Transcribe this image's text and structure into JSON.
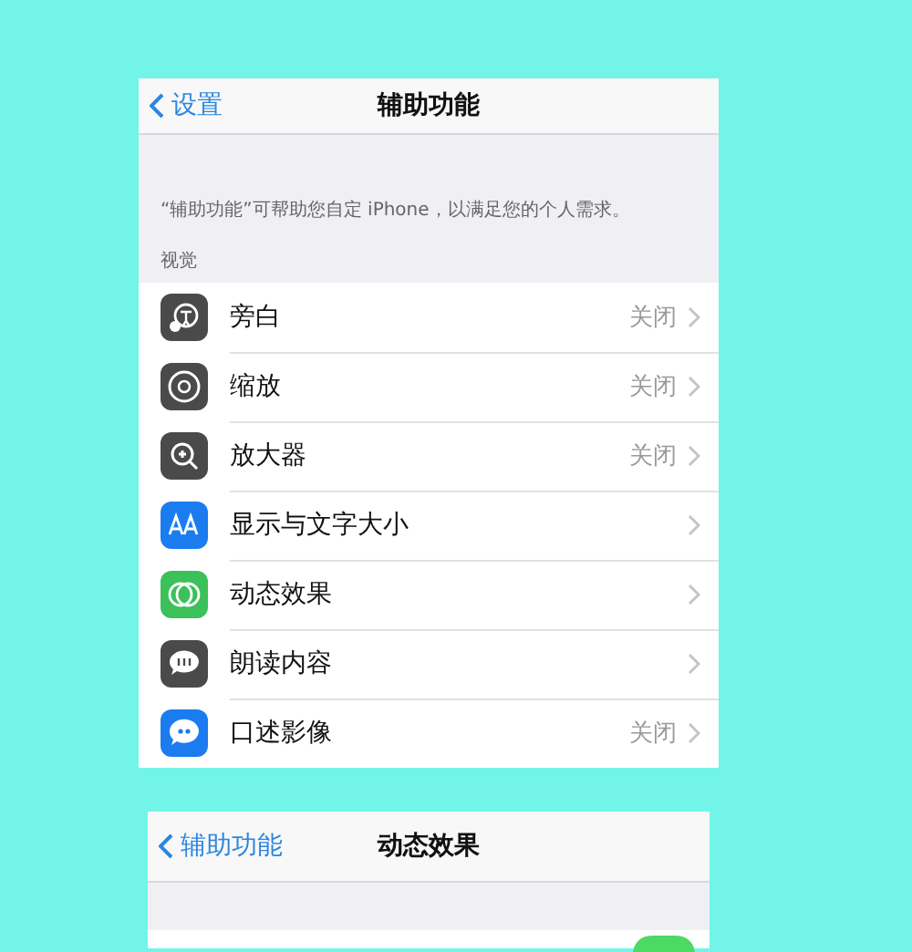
{
  "screens": [
    {
      "nav": {
        "back": "设置",
        "title": "辅助功能"
      },
      "description": "“辅助功能”可帮助您自定 iPhone，以满足您的个人需求。",
      "section": "视觉",
      "rows": [
        {
          "kind": "voiceover",
          "color": "#4a4a4a",
          "label": "旁白",
          "value": "关闭"
        },
        {
          "kind": "zoom",
          "color": "#4a4a4a",
          "label": "缩放",
          "value": "关闭"
        },
        {
          "kind": "magnifier",
          "color": "#4a4a4a",
          "label": "放大器",
          "value": "关闭"
        },
        {
          "kind": "textsize",
          "color": "#1b7cf0",
          "label": "显示与文字大小"
        },
        {
          "kind": "motion",
          "color": "#3cc05a",
          "label": "动态效果"
        },
        {
          "kind": "speech",
          "color": "#4a4a4a",
          "label": "朗读内容"
        },
        {
          "kind": "description",
          "color": "#1b7cf0",
          "label": "口述影像",
          "value": "关闭"
        }
      ]
    },
    {
      "nav": {
        "back": "辅助功能",
        "title": "动态效果"
      },
      "toggle": {
        "on": true
      }
    }
  ]
}
